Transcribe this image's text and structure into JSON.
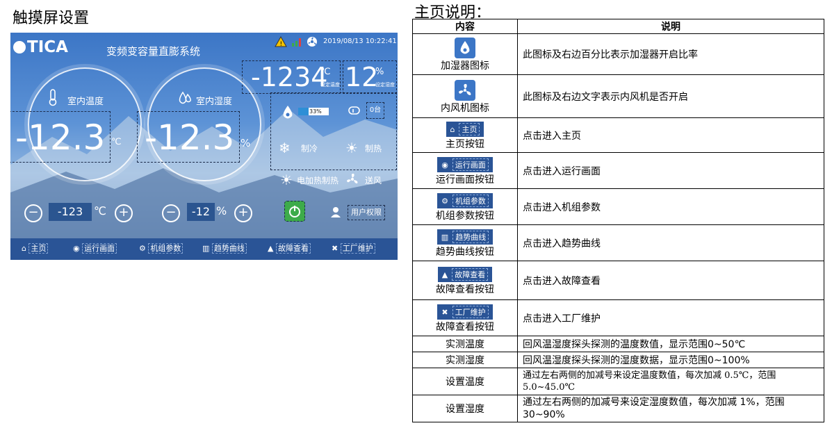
{
  "left_title": "触摸屏设置",
  "right_title": "主页说明：",
  "screen": {
    "logo": "TICA",
    "system_title": "变频变容量直膨系统",
    "datetime": "2019/08/13 10:22:41",
    "set_temp_value": "-1234",
    "set_temp_unit": "℃",
    "set_temp_caption": "设定温度",
    "set_hum_value": "12",
    "set_hum_unit": "%",
    "set_hum_caption": "设定湿度",
    "indoor_temp_label": "室内温度",
    "indoor_temp_value": "-12.3",
    "indoor_temp_unit": "℃",
    "indoor_hum_label": "室内湿度",
    "indoor_hum_value": "-12.3",
    "indoor_hum_unit": "%",
    "humidifier_percent": "33%",
    "humidifier_level": 0.33,
    "fan_status": "0台",
    "cooling": "制冷",
    "heating": "制热",
    "electric_heating": "电加热制热",
    "air_supply": "送风",
    "temp_set_value": "-123",
    "temp_set_unit": "℃",
    "hum_set_value": "-12",
    "hum_set_unit": "%",
    "user_permission": "用户权限",
    "colors": {
      "panel": "#3c76c6",
      "nav": "#2a5496",
      "power": "#3dab4a",
      "warning": "#f2c200"
    },
    "nav": [
      "主页",
      "运行画面",
      "机组参数",
      "趋势曲线",
      "故障查看",
      "工厂维护"
    ]
  },
  "table": {
    "headers": [
      "内容",
      "说明"
    ],
    "rows": [
      {
        "name": "加湿器图标",
        "icon": "humidifier-icon",
        "desc": "此图标及右边百分比表示加湿器开启比率"
      },
      {
        "name": "内风机图标",
        "icon": "fan-icon",
        "desc": "此图标及右边文字表示内风机是否开启"
      },
      {
        "name": "主页按钮",
        "icon": "home-icon",
        "btn": "主页",
        "desc": "点击进入主页"
      },
      {
        "name": "运行画面按钮",
        "icon": "run-icon",
        "btn": "运行画面",
        "desc": "点击进入运行画面"
      },
      {
        "name": "机组参数按钮",
        "icon": "unit-params-icon",
        "btn": "机组参数",
        "desc": "点击进入机组参数"
      },
      {
        "name": "趋势曲线按钮",
        "icon": "trend-icon",
        "btn": "趋势曲线",
        "desc": "点击进入趋势曲线"
      },
      {
        "name": "故障查看按钮",
        "icon": "warning-icon",
        "btn": "故障查看",
        "desc": "点击进入故障查看"
      },
      {
        "name": "故障查看按钮",
        "icon": "tools-icon",
        "btn": "工厂维护",
        "desc": "点击进入工厂维护"
      },
      {
        "name": "实测温度",
        "desc": "回风温湿度探头探测的温度数值，显示范围0~50℃"
      },
      {
        "name": "实测湿度",
        "desc": "回风温湿度探头探测的湿度数据，显示范围0~100%"
      },
      {
        "name": "设置温度",
        "desc": "通过左右两侧的加减号来设定温度数值，每次加减 0.5℃，范围5.0~45.0℃"
      },
      {
        "name": "设置湿度",
        "desc": "通过左右两侧的加减号来设定湿度数值，每次加减 1%，范围30~90%"
      }
    ]
  }
}
